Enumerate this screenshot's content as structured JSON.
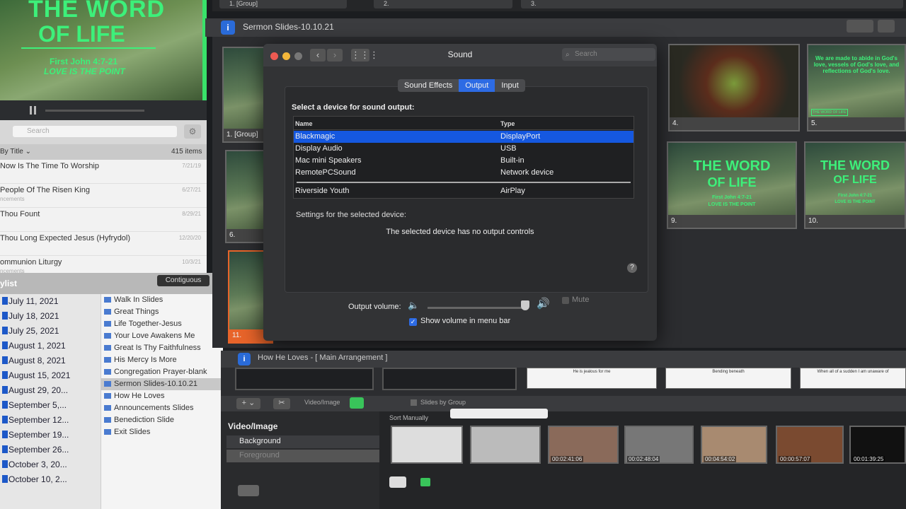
{
  "preview": {
    "line1": "THE WORD",
    "line2": "OF LIFE",
    "line3": "First John 4:7-21",
    "line4": "LOVE IS THE POINT"
  },
  "library": {
    "search_placeholder": "Search",
    "sort_label": "By Title",
    "item_count": "415 items",
    "songs": [
      {
        "name": "Now Is The Time To Worship",
        "sub": "",
        "date": "7/21/19"
      },
      {
        "name": "People Of The Risen King",
        "sub": "ncements",
        "date": "6/27/21"
      },
      {
        "name": "Thou Fount",
        "sub": "",
        "date": "8/29/21"
      },
      {
        "name": "Thou Long Expected Jesus (Hyfrydol)",
        "sub": "",
        "date": "12/20/20"
      },
      {
        "name": "ommunion Liturgy",
        "sub": "ncements",
        "date": "10/3/21"
      }
    ]
  },
  "playlist": {
    "label": "ylist",
    "contiguous": "Contiguous",
    "dates": [
      "July 11, 2021",
      "July 18, 2021",
      "July 25, 2021",
      "August 1, 2021",
      "August 8, 2021",
      "August 15, 2021",
      "August 29, 20...",
      "September 5,...",
      "September 12...",
      "September 19...",
      "September 26...",
      "October 3, 20...",
      "October 10, 2..."
    ],
    "items": [
      "Walk In Slides",
      "Great Things",
      "Life Together-Jesus",
      "Your Love Awakens Me",
      "Great Is Thy Faithfulness",
      "His Mercy Is More",
      "Congregation Prayer-blank",
      "Sermon Slides-10.10.21",
      "How He Loves",
      "Announcements Slides",
      "Benediction Slide",
      "Exit Slides"
    ],
    "selected_index": 7
  },
  "top_tabs": [
    "1. [Group]",
    "2.",
    "3."
  ],
  "sermon_bar": {
    "title": "Sermon Slides-10.10.21"
  },
  "slides": [
    {
      "label": "1. [Group]"
    },
    {
      "label": "6."
    },
    {
      "label": "11."
    },
    {
      "label": "4."
    },
    {
      "label": "5."
    },
    {
      "label": "9."
    },
    {
      "label": "10."
    }
  ],
  "slide_texts": {
    "title_a": "THE WORD",
    "title_b": "OF LIFE",
    "sub_a": "First John 4:7-21",
    "sub_b": "LOVE IS THE POINT",
    "abide": "We are made to abide in God's love, vessels of God's love, and reflections of God's love.",
    "badge": "THE WORD OF LIFE"
  },
  "dialog": {
    "title": "Sound",
    "search_placeholder": "Search",
    "tabs": [
      "Sound Effects",
      "Output",
      "Input"
    ],
    "active_tab": "Output",
    "select_label": "Select a device for sound output:",
    "col_name": "Name",
    "col_type": "Type",
    "devices": [
      {
        "name": "Blackmagic",
        "type": "DisplayPort",
        "selected": true
      },
      {
        "name": "Display Audio",
        "type": "USB",
        "selected": false
      },
      {
        "name": "Mac mini Speakers",
        "type": "Built-in",
        "selected": false
      },
      {
        "name": "RemotePCSound",
        "type": "Network device",
        "selected": false
      },
      {
        "name": "Riverside Youth",
        "type": "AirPlay",
        "selected": false
      }
    ],
    "settings_label": "Settings for the selected device:",
    "no_controls": "The selected device has no output controls",
    "help": "?",
    "volume_label": "Output volume:",
    "volume_level": 0.95,
    "mute_label": "Mute",
    "show_volume_label": "Show volume in menu bar",
    "show_volume_checked": true
  },
  "how_bar": {
    "title": "How He Loves - [ Main Arrangement ]"
  },
  "lyric_thumbs": [
    "He is jealous for me",
    "Bending beneath",
    "When all of a sudden I am unaware of"
  ],
  "media": {
    "video_image_label": "Video/Image",
    "slides_by_group": "Slides by Group",
    "sort_label": "Sort Manually",
    "category": "Video/Image",
    "layers": [
      "Background",
      "Foreground"
    ],
    "times": [
      "00:02:41:06",
      "00:02:48:04",
      "00:04:54:02",
      "00:00:57:07",
      "00:01:39:25"
    ]
  },
  "colors": {
    "accent": "#2d6be4",
    "green": "#39e26a",
    "selection": "#1558e0"
  }
}
